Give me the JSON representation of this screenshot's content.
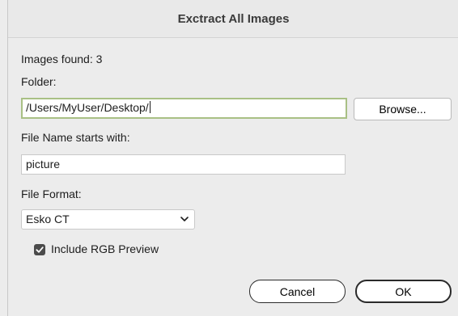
{
  "dialog": {
    "title": "Exctract All Images"
  },
  "images_found": {
    "text": "Images found: 3"
  },
  "folder": {
    "label": "Folder:",
    "value": "/Users/MyUser/Desktop/",
    "browse_label": "Browse..."
  },
  "file_name": {
    "label": "File Name starts with:",
    "value": "picture"
  },
  "file_format": {
    "label": "File Format:",
    "selected": "Esko CT"
  },
  "include_rgb_preview": {
    "label": "Include RGB Preview",
    "checked": true
  },
  "actions": {
    "cancel_label": "Cancel",
    "ok_label": "OK"
  }
}
